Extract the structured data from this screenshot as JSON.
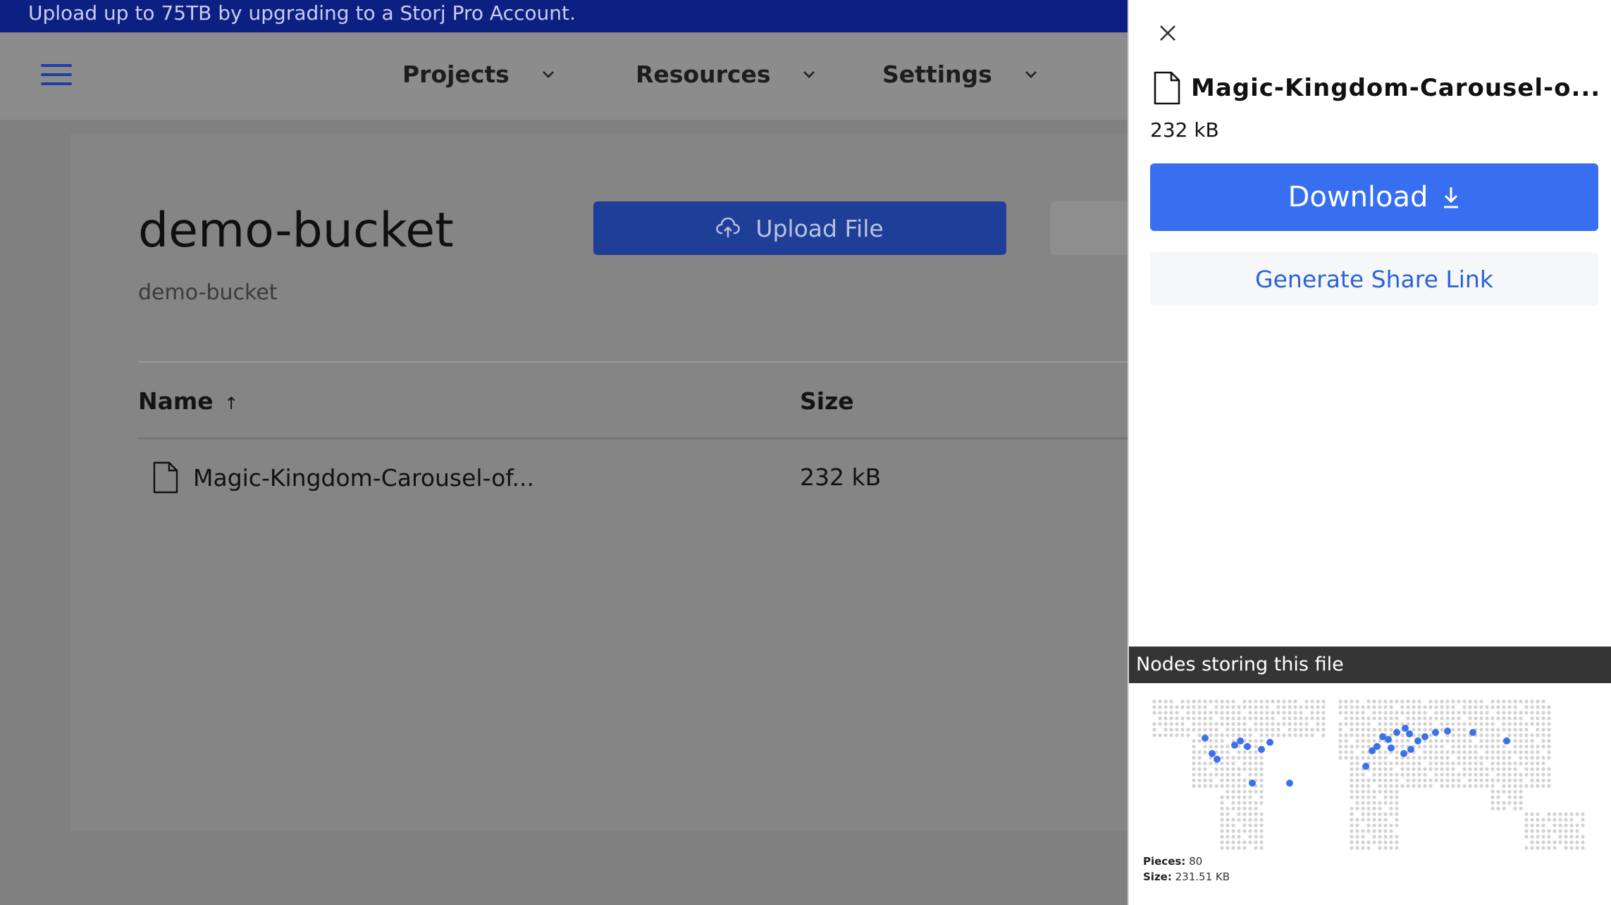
{
  "banner": {
    "text": "Upload up to 75TB by upgrading to a Storj Pro Account."
  },
  "nav": {
    "items": [
      {
        "label": "Projects"
      },
      {
        "label": "Resources"
      },
      {
        "label": "Settings"
      }
    ]
  },
  "bucket": {
    "title": "demo-bucket",
    "subtitle": "demo-bucket",
    "upload_label": "Upload File"
  },
  "table": {
    "columns": {
      "name": "Name",
      "size": "Size"
    },
    "rows": [
      {
        "name": "Magic-Kingdom-Carousel-of...",
        "size": "232 kB"
      }
    ]
  },
  "panel": {
    "filename": "Magic-Kingdom-Carousel-o...",
    "size": "232 kB",
    "download_label": "Download",
    "share_label": "Generate Share Link",
    "nodes_title": "Nodes storing this file",
    "pieces_label": "Pieces:",
    "pieces_value": "80",
    "size_label": "Size:",
    "size_value": "231.51 KB"
  },
  "colors": {
    "accent": "#376ff0",
    "banner": "#0c2081",
    "node_dot": "#3b72e8"
  }
}
